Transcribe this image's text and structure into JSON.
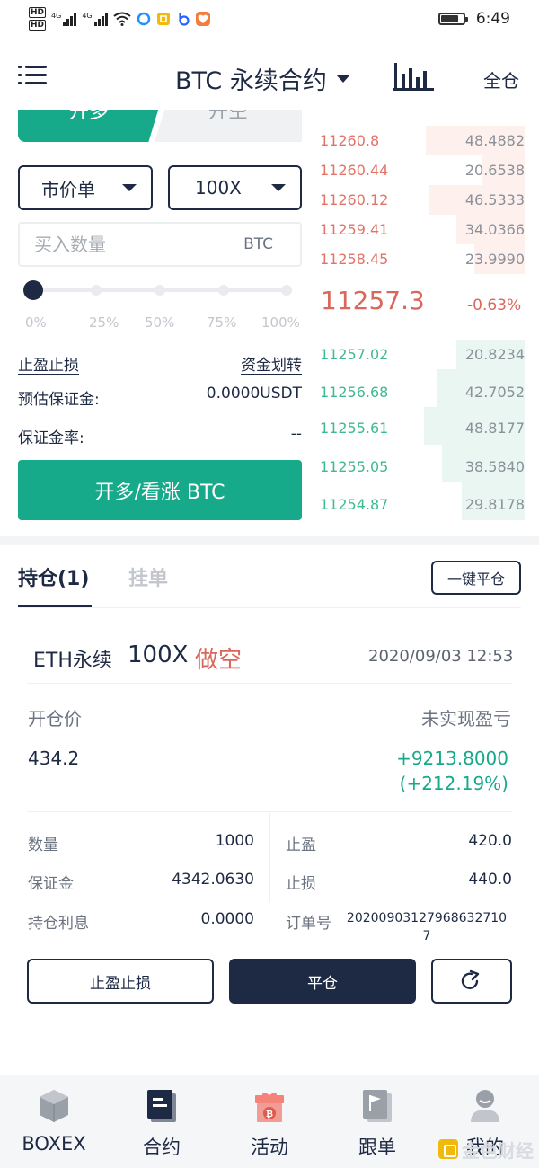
{
  "status_bar": {
    "time": "6:49",
    "net1": "4G",
    "net2": "4G",
    "hd1": "HD",
    "hd2": "HD"
  },
  "header": {
    "title": "BTC 永续合约",
    "right_label": "全仓"
  },
  "trade": {
    "tab_long": "开多",
    "tab_short": "开空",
    "order_type": "市价单",
    "leverage": "100X",
    "qty_placeholder": "买入数量",
    "qty_unit": "BTC",
    "slider_percent": 0,
    "slider_marks": [
      "0%",
      "25%",
      "50%",
      "75%",
      "100%"
    ],
    "tp_sl_link": "止盈止损",
    "transfer_link": "资金划转",
    "est_margin_label": "预估保证金:",
    "est_margin_value": "0.0000USDT",
    "margin_rate_label": "保证金率:",
    "margin_rate_value": "--",
    "buy_button": "开多/看涨 BTC"
  },
  "order_book": {
    "asks": [
      {
        "price": "11260.8",
        "amount": "48.4882"
      },
      {
        "price": "11260.44",
        "amount": "20.6538"
      },
      {
        "price": "11260.12",
        "amount": "46.5333"
      },
      {
        "price": "11259.41",
        "amount": "34.0366"
      },
      {
        "price": "11258.45",
        "amount": "23.9990"
      }
    ],
    "last_price": "11257.3",
    "change": "-0.63%",
    "bids": [
      {
        "price": "11257.02",
        "amount": "20.8234"
      },
      {
        "price": "11256.68",
        "amount": "42.7052"
      },
      {
        "price": "11255.61",
        "amount": "48.8177"
      },
      {
        "price": "11255.05",
        "amount": "38.5840"
      },
      {
        "price": "11254.87",
        "amount": "29.8178"
      }
    ]
  },
  "positions": {
    "tab_positions": "持仓(1)",
    "tab_orders": "挂单",
    "close_all_button": "一键平仓",
    "item": {
      "symbol": "ETH永续",
      "leverage": "100X",
      "side": "做空",
      "time": "2020/09/03 12:53",
      "entry_label": "开仓价",
      "entry_value": "434.2",
      "pnl_label": "未实现盈亏",
      "pnl_value": "+9213.8000",
      "pnl_percent": "(+212.19%)",
      "qty_label": "数量",
      "qty_value": "1000",
      "margin_label": "保证金",
      "margin_value": "4342.0630",
      "interest_label": "持仓利息",
      "interest_value": "0.0000",
      "tp_label": "止盈",
      "tp_value": "420.0",
      "sl_label": "止损",
      "sl_value": "440.0",
      "order_no_label": "订单号",
      "order_no_value": "20200903127968632710 7",
      "tpsl_button": "止盈止损",
      "close_button": "平仓"
    }
  },
  "bottom_nav": [
    {
      "label": "BOXEX",
      "icon": "cube-icon"
    },
    {
      "label": "合约",
      "icon": "contract-icon"
    },
    {
      "label": "活动",
      "icon": "gift-icon"
    },
    {
      "label": "跟单",
      "icon": "copy-trade-icon"
    },
    {
      "label": "我的",
      "icon": "profile-icon"
    }
  ],
  "watermark": "金色财经",
  "colors": {
    "green": "#16a98a",
    "red": "#d9675c",
    "navy": "#1e2a44"
  }
}
